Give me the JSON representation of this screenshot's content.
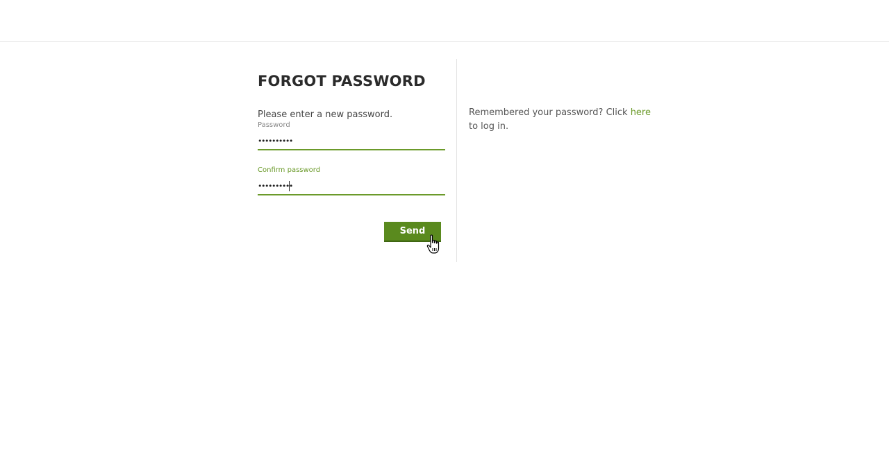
{
  "form": {
    "title": "FORGOT PASSWORD",
    "instruction": "Please enter a new password.",
    "password_label": "Password",
    "password_value": "••••••••••",
    "confirm_label": "Confirm password",
    "confirm_value": "••••••••••",
    "send_label": "Send"
  },
  "aside": {
    "text_before": "Remembered your password? Click ",
    "link_text": "here",
    "text_after": " to log in."
  },
  "colors": {
    "accent": "#6b9a2a",
    "button": "#5a8a1e"
  },
  "icons": {
    "cursor": "hand-pointer-cursor"
  }
}
